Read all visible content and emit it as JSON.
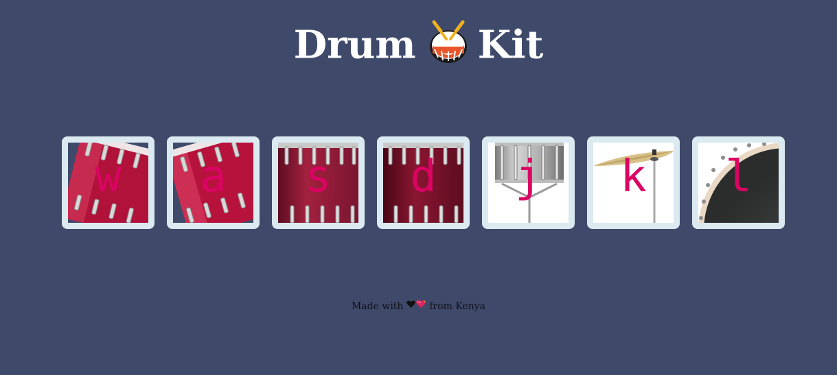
{
  "header": {
    "title_word_1": "Drum",
    "title_icon": "drum-emoji",
    "title_word_2": "Kit"
  },
  "drums": [
    {
      "key": "w",
      "instrument_icon": "tom-tilted"
    },
    {
      "key": "a",
      "instrument_icon": "tom-tilted"
    },
    {
      "key": "s",
      "instrument_icon": "snare-red"
    },
    {
      "key": "d",
      "instrument_icon": "snare-dark-red"
    },
    {
      "key": "j",
      "instrument_icon": "snare-silver-on-stand"
    },
    {
      "key": "k",
      "instrument_icon": "crash-cymbal"
    },
    {
      "key": "l",
      "instrument_icon": "bass-drum-head"
    }
  ],
  "footer": {
    "text_before": "Made with",
    "heart_icons": [
      "black-heart",
      "sparkling-heart"
    ],
    "text_after": "from Kenya"
  },
  "colors": {
    "background": "#3f4a6a",
    "tile_border": "#dbe9f1",
    "key_letter": "#da0463",
    "title": "#ffffff",
    "footer_text": "#0f0f17"
  }
}
